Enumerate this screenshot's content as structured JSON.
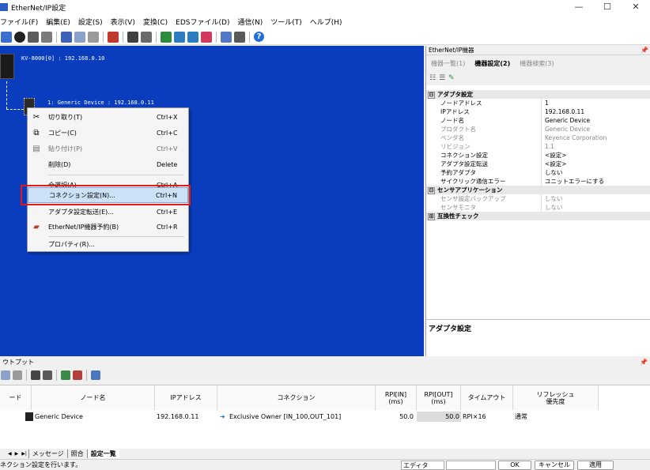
{
  "window": {
    "title": "EtherNet/IP設定",
    "minimize": "—",
    "maximize": "☐",
    "close": "✕"
  },
  "menu": [
    "ファイル(F)",
    "編集(E)",
    "設定(S)",
    "表示(V)",
    "変換(C)",
    "EDSファイル(D)",
    "通信(N)",
    "ツール(T)",
    "ヘルプ(H)"
  ],
  "toolbar": {
    "icons": [
      "disconnect-icon",
      "monitor-icon",
      "scan-icon",
      "network-icon",
      "cut-icon",
      "copy-icon",
      "paste-icon",
      "device-add-icon",
      "window-icon",
      "edit-icon",
      "connection-icon",
      "search-icon",
      "zoom-icon",
      "check-icon",
      "list-icon",
      "table-icon",
      "help-icon"
    ],
    "help": "?"
  },
  "canvas": {
    "plc_label": "KV-8000[0] : 192.168.0.10",
    "device_label": "1: Generic Device : 192.168.0.11"
  },
  "context_menu": [
    {
      "label": "切り取り(T)",
      "shortcut": "Ctrl+X",
      "icon": "scissors-icon",
      "disabled": false
    },
    {
      "label": "コピー(C)",
      "shortcut": "Ctrl+C",
      "icon": "copy-icon",
      "disabled": false
    },
    {
      "label": "貼り付け(P)",
      "shortcut": "Ctrl+V",
      "icon": "paste-icon",
      "disabled": true
    },
    {
      "label": "削除(D)",
      "shortcut": "Delete",
      "icon": "",
      "disabled": false
    },
    {
      "label": "全選択(A)",
      "shortcut": "Ctrl+A",
      "icon": "",
      "disabled": false
    },
    {
      "label": "コネクション設定(N)...",
      "shortcut": "Ctrl+N",
      "icon": "",
      "disabled": false,
      "highlight": true
    },
    {
      "label": "アダプタ設定転送(E)...",
      "shortcut": "Ctrl+E",
      "icon": "",
      "disabled": false
    },
    {
      "label": "EtherNet/IP機器予約(B)",
      "shortcut": "Ctrl+R",
      "icon": "reserve-icon",
      "disabled": false
    },
    {
      "label": "プロパティ(R)...",
      "shortcut": "",
      "icon": "",
      "disabled": false
    }
  ],
  "right_panel": {
    "header": "EtherNet/IP機器",
    "pin": "📌",
    "tabs": [
      "機器一覧(1)",
      "機器設定(2)",
      "機器検索(3)"
    ],
    "active_tab": 1,
    "properties": [
      {
        "type": "cat",
        "name": "アダプタ設定",
        "toggle": "⊟"
      },
      {
        "name": "ノードアドレス",
        "value": "1"
      },
      {
        "name": "IPアドレス",
        "value": "192.168.0.11"
      },
      {
        "name": "ノード名",
        "value": "Generic Device"
      },
      {
        "name": "プロダクト名",
        "value": "Generic Device",
        "dim": true
      },
      {
        "name": "ベンダ名",
        "value": "Keyence Corporation",
        "dim": true
      },
      {
        "name": "リビジョン",
        "value": "1.1",
        "dim": true
      },
      {
        "name": "コネクション設定",
        "value": "<設定>"
      },
      {
        "name": "アダプタ設定転送",
        "value": "<設定>"
      },
      {
        "name": "予約アダプタ",
        "value": "しない"
      },
      {
        "name": "サイクリック通信エラー",
        "value": "ユニットエラーにする"
      },
      {
        "type": "cat",
        "name": "センサアプリケーション",
        "toggle": "⊟"
      },
      {
        "name": "センサ設定バックアップ",
        "value": "しない",
        "dim": true
      },
      {
        "name": "センサモニタ",
        "value": "しない",
        "dim": true
      },
      {
        "type": "cat",
        "name": "互換性チェック",
        "toggle": "⊞"
      }
    ],
    "description_title": "アダプタ設定"
  },
  "output": {
    "title": "ウトプット",
    "pin": "📌",
    "columns": [
      "ード",
      "ノード名",
      "IPアドレス",
      "コネクション",
      "RPI[IN]\n(ms)",
      "RPI[OUT]\n(ms)",
      "タイムアウト",
      "リフレッシュ\n優先度"
    ],
    "rows": [
      {
        "node_name": "Generic Device",
        "ip": "192.168.0.11",
        "connection": "Exclusive Owner [IN_100,OUT_101]",
        "rpi_in": "50.0",
        "rpi_out": "50.0",
        "timeout": "RPI×16",
        "priority": "通常"
      }
    ]
  },
  "bottom_tabs": {
    "nav": [
      "◀",
      "▶",
      "▶|"
    ],
    "tabs": [
      "メッセージ",
      "照合",
      "設定一覧"
    ],
    "active": 2
  },
  "status": {
    "message": "ネクション設定を行います。",
    "mode": "エディタ",
    "ok": "OK",
    "cancel": "キャンセル",
    "apply": "適用"
  },
  "colors": {
    "canvas": "#0a3dbe",
    "highlight_border": "#e11b1b"
  }
}
